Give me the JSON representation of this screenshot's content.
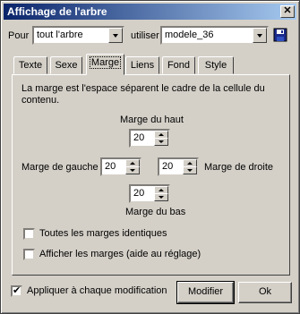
{
  "window": {
    "title": "Affichage de l'arbre",
    "close_glyph": "✕"
  },
  "header": {
    "pour_label": "Pour",
    "pour_value": "tout l'arbre",
    "utiliser_label": "utiliser",
    "utiliser_value": "modele_36"
  },
  "tabs": [
    {
      "label": "Texte"
    },
    {
      "label": "Sexe"
    },
    {
      "label": "Marge",
      "active": true
    },
    {
      "label": "Liens"
    },
    {
      "label": "Fond"
    },
    {
      "label": "Style"
    }
  ],
  "marge": {
    "description_line1": "La marge est l'espace séparent le cadre de la cellule du",
    "description_line2": "contenu.",
    "haut_label": "Marge du haut",
    "haut_value": "20",
    "gauche_label": "Marge de gauche",
    "gauche_value": "20",
    "droite_label": "Marge de droite",
    "droite_value": "20",
    "bas_label": "Marge du bas",
    "bas_value": "20",
    "identiques_label": "Toutes les marges identiques",
    "afficher_label": "Afficher les marges (aide au réglage)"
  },
  "footer": {
    "appliquer_label": "Appliquer à chaque modification",
    "modifier_label": "Modifier",
    "ok_label": "Ok"
  }
}
